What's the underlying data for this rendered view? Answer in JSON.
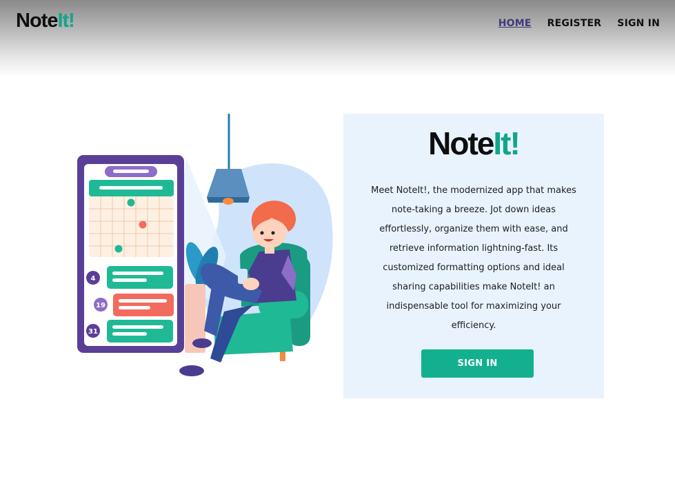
{
  "header": {
    "logo": {
      "part1": "Note",
      "part2": "It!"
    },
    "nav": {
      "home": "HOME",
      "register": "REGISTER",
      "signin": "SIGN IN"
    }
  },
  "hero": {
    "calendar_badges": [
      "4",
      "19",
      "31"
    ]
  },
  "card": {
    "brand": {
      "part1": "Note",
      "part2": "It!"
    },
    "description": "Meet NoteIt!, the modernized app that makes note-taking a breeze. Jot down ideas effortlessly, organize them with ease, and retrieve information lightning-fast. Its customized formatting options and ideal sharing capabilities make NoteIt! an indispensable tool for maximizing your efficiency.",
    "signin_label": "SIGN IN"
  },
  "colors": {
    "accent": "#12b08e",
    "logo_green": "#12a58c",
    "active_nav": "#3f3a7a",
    "card_bg": "#e8f3fd",
    "purple": "#5a3f97",
    "coral": "#f26b5e"
  }
}
